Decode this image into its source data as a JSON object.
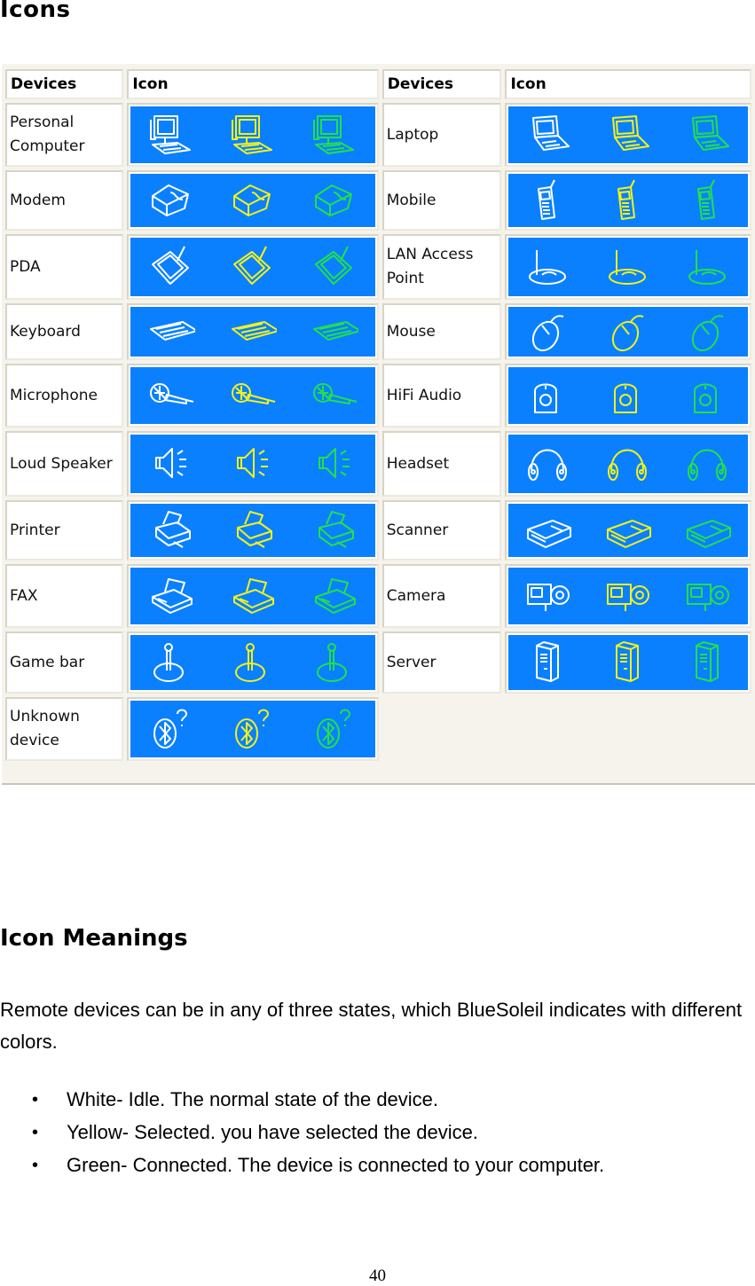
{
  "title": "Icons",
  "table": {
    "headers": [
      "Devices",
      "Icon",
      "Devices",
      "Icon"
    ],
    "colors": {
      "background": "#0a80ff",
      "idle": "#ffffff",
      "selected": "#f2f21a",
      "connected": "#22e04a"
    },
    "rows": [
      {
        "left": {
          "label": "Personal Computer",
          "icon": "personal-computer-icon"
        },
        "right": {
          "label": "Laptop",
          "icon": "laptop-icon"
        }
      },
      {
        "left": {
          "label": "Modem",
          "icon": "modem-icon"
        },
        "right": {
          "label": "Mobile",
          "icon": "mobile-phone-icon"
        }
      },
      {
        "left": {
          "label": "PDA",
          "icon": "pda-icon"
        },
        "right": {
          "label": "LAN Access Point",
          "icon": "lan-access-point-icon"
        }
      },
      {
        "left": {
          "label": "Keyboard",
          "icon": "keyboard-icon"
        },
        "right": {
          "label": "Mouse",
          "icon": "mouse-icon"
        }
      },
      {
        "left": {
          "label": "Microphone",
          "icon": "microphone-icon"
        },
        "right": {
          "label": "HiFi Audio",
          "icon": "hifi-audio-icon"
        }
      },
      {
        "left": {
          "label": "Loud Speaker",
          "icon": "loud-speaker-icon"
        },
        "right": {
          "label": "Headset",
          "icon": "headset-icon"
        }
      },
      {
        "left": {
          "label": "Printer",
          "icon": "printer-icon"
        },
        "right": {
          "label": "Scanner",
          "icon": "scanner-icon"
        }
      },
      {
        "left": {
          "label": "FAX",
          "icon": "fax-icon"
        },
        "right": {
          "label": "Camera",
          "icon": "camera-icon"
        }
      },
      {
        "left": {
          "label": "Game bar",
          "icon": "game-bar-icon"
        },
        "right": {
          "label": "Server",
          "icon": "server-icon"
        }
      },
      {
        "left": {
          "label": "Unknown device",
          "icon": "unknown-device-icon"
        },
        "right": null
      }
    ]
  },
  "meanings": {
    "heading": "Icon Meanings",
    "intro": "Remote devices can be in any of three states, which BlueSoleil indicates with different colors.",
    "states": [
      "White- Idle. The normal state of the device.",
      "Yellow- Selected. you have selected the device.",
      "Green- Connected. The device is connected to your computer."
    ]
  },
  "page_number": "40"
}
